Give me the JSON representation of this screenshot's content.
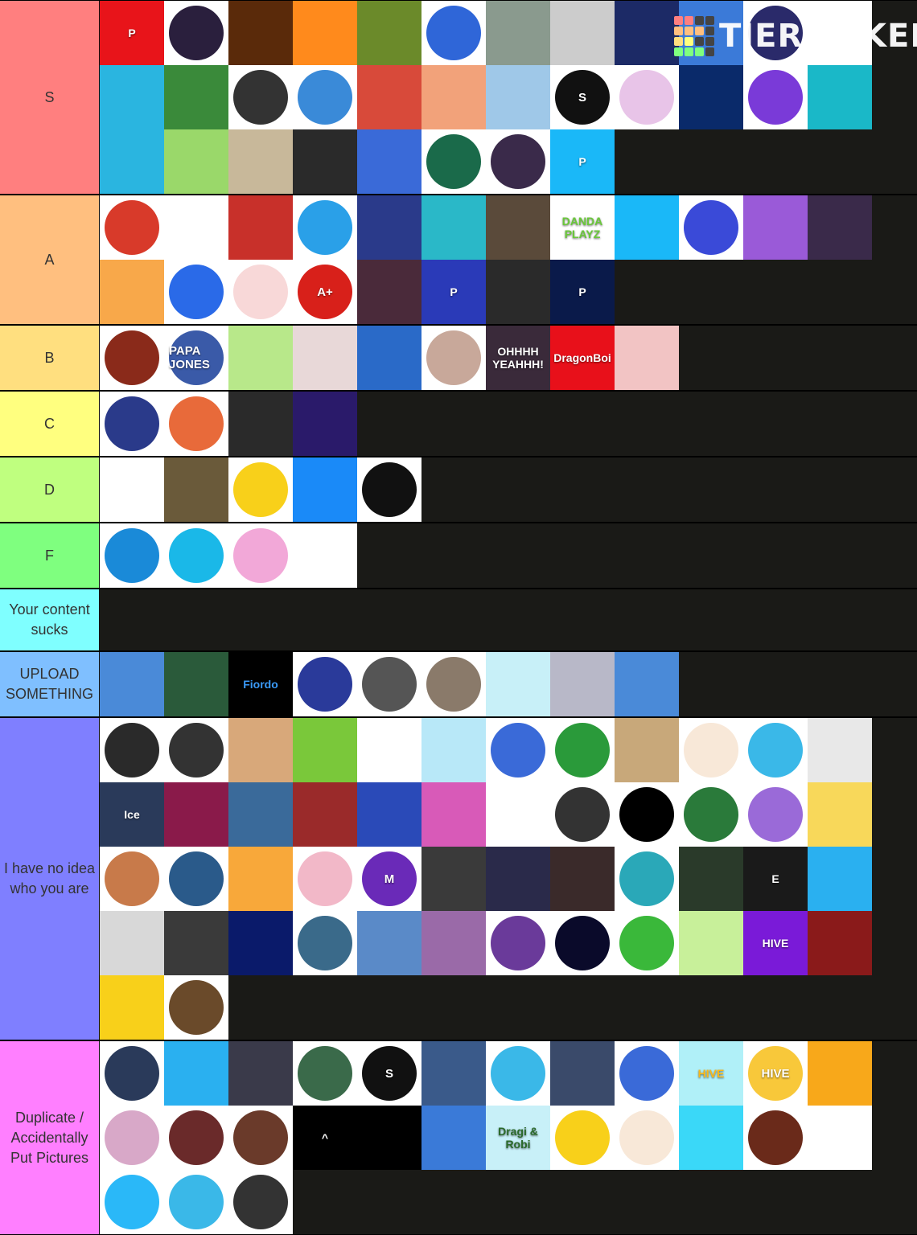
{
  "watermark": {
    "text": "TIERMAKER",
    "grid_colors": [
      "#ff7f7f",
      "#ff7f7f",
      "#444",
      "#444",
      "#ffbf7f",
      "#ffbf7f",
      "#ffbf7f",
      "#444",
      "#ffdf7f",
      "#ffff7f",
      "#444",
      "#444",
      "#7fff7f",
      "#7fff7f",
      "#7fff7f",
      "#444"
    ]
  },
  "tiers": [
    {
      "label": "S",
      "color": "#ff7f7f",
      "items": [
        {
          "bg": "#e8141a",
          "shape": "sq",
          "text": "P"
        },
        {
          "bg": "#fff",
          "fg": "#2a1f3d",
          "shape": "disc",
          "text": ""
        },
        {
          "bg": "#5a2a0a",
          "shape": "sq",
          "text": ""
        },
        {
          "bg": "#ff8a1c",
          "shape": "sq",
          "text": ""
        },
        {
          "bg": "#6b8a2a",
          "shape": "sq",
          "text": ""
        },
        {
          "bg": "#fff",
          "fg": "#2f66d8",
          "shape": "disc",
          "text": ""
        },
        {
          "bg": "#8a9a8e",
          "shape": "sq",
          "text": ""
        },
        {
          "bg": "#ccc",
          "fg": "#8a4a2a",
          "shape": "sq",
          "text": ""
        },
        {
          "bg": "#1c2a66",
          "shape": "sq",
          "text": ""
        },
        {
          "bg": "#3b7ad8",
          "shape": "sq",
          "text": ""
        },
        {
          "bg": "#fff",
          "fg": "#2a2a6a",
          "shape": "disc",
          "text": ""
        },
        {
          "bg": "#fff",
          "fg": "#7a5a2a",
          "shape": "sq",
          "text": ""
        },
        {
          "bg": "#2ab5e0",
          "shape": "sq",
          "text": ""
        },
        {
          "bg": "#3a8a3a",
          "shape": "sq",
          "text": ""
        },
        {
          "bg": "#fff",
          "fg": "#333",
          "shape": "disc",
          "text": ""
        },
        {
          "bg": "#fff",
          "fg": "#3a8ad8",
          "shape": "disc",
          "text": ""
        },
        {
          "bg": "#d84a3a",
          "shape": "sq",
          "text": ""
        },
        {
          "bg": "#f2a27a",
          "shape": "sq",
          "text": ""
        },
        {
          "bg": "#9fc8e8",
          "shape": "sq",
          "text": ""
        },
        {
          "bg": "#fff",
          "fg": "#111",
          "shape": "disc",
          "text": "S"
        },
        {
          "bg": "#fff",
          "fg": "#e8c4e8",
          "shape": "disc",
          "text": ""
        },
        {
          "bg": "#0a2a6a",
          "shape": "sq",
          "text": ""
        },
        {
          "bg": "#fff",
          "fg": "#7a3ad8",
          "shape": "disc",
          "text": ""
        },
        {
          "bg": "#1ab8c8",
          "shape": "sq",
          "text": ""
        },
        {
          "bg": "#2ab5e0",
          "shape": "sq",
          "text": ""
        },
        {
          "bg": "#9ad86a",
          "shape": "sq",
          "text": ""
        },
        {
          "bg": "#c8b89a",
          "shape": "sq",
          "text": ""
        },
        {
          "bg": "#2a2a2a",
          "shape": "sq",
          "text": ""
        },
        {
          "bg": "#3a6ad8",
          "shape": "sq",
          "text": ""
        },
        {
          "bg": "#fff",
          "fg": "#1a6a4a",
          "shape": "disc",
          "text": ""
        },
        {
          "bg": "#fff",
          "fg": "#3a2a4a",
          "shape": "disc",
          "text": ""
        },
        {
          "bg": "#1ab8f8",
          "shape": "sq",
          "text": "P"
        }
      ]
    },
    {
      "label": "A",
      "color": "#ffbf7f",
      "items": [
        {
          "bg": "#fff",
          "fg": "#d83a2a",
          "shape": "disc",
          "text": ""
        },
        {
          "bg": "#fff",
          "fg": "#111",
          "shape": "sq",
          "text": ""
        },
        {
          "bg": "#c8302a",
          "shape": "sq",
          "text": ""
        },
        {
          "bg": "#fff",
          "fg": "#2aa0e8",
          "shape": "disc",
          "text": ""
        },
        {
          "bg": "#2a3a8a",
          "shape": "sq",
          "text": ""
        },
        {
          "bg": "#2ab8c8",
          "shape": "sq",
          "text": ""
        },
        {
          "bg": "#5a4a3a",
          "shape": "sq",
          "text": ""
        },
        {
          "bg": "#fff",
          "fg": "#6ac83a",
          "shape": "sq",
          "text": "DANDA PLAYZ"
        },
        {
          "bg": "#1ab8f8",
          "shape": "sq",
          "text": ""
        },
        {
          "bg": "#fff",
          "fg": "#3a4ad8",
          "shape": "disc",
          "text": ""
        },
        {
          "bg": "#9a5ad8",
          "shape": "sq",
          "text": ""
        },
        {
          "bg": "#3a2a4a",
          "shape": "sq",
          "text": ""
        },
        {
          "bg": "#f8a84a",
          "shape": "sq",
          "text": ""
        },
        {
          "bg": "#fff",
          "fg": "#2a6ae8",
          "shape": "disc",
          "text": ""
        },
        {
          "bg": "#fff",
          "fg": "#f8d8d8",
          "shape": "disc",
          "text": ""
        },
        {
          "bg": "#fff",
          "fg": "#d8201a",
          "shape": "disc",
          "text": "A+"
        },
        {
          "bg": "#4a2a3a",
          "shape": "sq",
          "text": ""
        },
        {
          "bg": "#2a3ab8",
          "shape": "sq",
          "text": "P"
        },
        {
          "bg": "#2a2a2a",
          "shape": "sq",
          "text": ""
        },
        {
          "bg": "#0a1a4a",
          "shape": "sq",
          "text": "P"
        }
      ]
    },
    {
      "label": "B",
      "color": "#ffdf7f",
      "items": [
        {
          "bg": "#fff",
          "fg": "#8a2a1a",
          "shape": "disc",
          "text": ""
        },
        {
          "bg": "#fff",
          "fg": "#3a5aa8",
          "shape": "disc",
          "text": "PAPA JONES"
        },
        {
          "bg": "#b8e88a",
          "shape": "sq",
          "text": ""
        },
        {
          "bg": "#e8d8d8",
          "shape": "sq",
          "text": ""
        },
        {
          "bg": "#2a6ac8",
          "shape": "sq",
          "text": ""
        },
        {
          "bg": "#fff",
          "fg": "#c8a89a",
          "shape": "disc",
          "text": ""
        },
        {
          "bg": "#3a2a3a",
          "shape": "sq",
          "text": "OHHHH YEAHHH!"
        },
        {
          "bg": "#e8101a",
          "shape": "sq",
          "text": "DragonBoi"
        },
        {
          "bg": "#f2c4c4",
          "shape": "sq",
          "text": ""
        }
      ]
    },
    {
      "label": "C",
      "color": "#ffff7f",
      "items": [
        {
          "bg": "#fff",
          "fg": "#2a3a8a",
          "shape": "disc",
          "text": ""
        },
        {
          "bg": "#fff",
          "fg": "#e86a3a",
          "shape": "disc",
          "text": ""
        },
        {
          "bg": "#2a2a2a",
          "shape": "sq",
          "text": ""
        },
        {
          "bg": "#2a1a6a",
          "shape": "sq",
          "text": ""
        }
      ]
    },
    {
      "label": "D",
      "color": "#bfff7f",
      "items": [
        {
          "bg": "#fff",
          "fg": "#f8d83a",
          "shape": "sq",
          "text": ""
        },
        {
          "bg": "#6a5a3a",
          "shape": "sq",
          "text": ""
        },
        {
          "bg": "#fff",
          "fg": "#f8d01a",
          "shape": "disc",
          "text": ""
        },
        {
          "bg": "#1a8af8",
          "shape": "sq",
          "text": ""
        },
        {
          "bg": "#fff",
          "fg": "#111",
          "shape": "disc",
          "text": ""
        }
      ]
    },
    {
      "label": "F",
      "color": "#7fff7f",
      "items": [
        {
          "bg": "#fff",
          "fg": "#1a8ad8",
          "shape": "disc",
          "text": ""
        },
        {
          "bg": "#fff",
          "fg": "#1ab8e8",
          "shape": "disc",
          "text": ""
        },
        {
          "bg": "#fff",
          "fg": "#f2a8d8",
          "shape": "disc",
          "text": ""
        },
        {
          "bg": "#fff",
          "fg": "#d82a3a",
          "shape": "sq",
          "text": ""
        }
      ]
    },
    {
      "label": "Your content sucks",
      "color": "#7fffff",
      "items": []
    },
    {
      "label": "UPLOAD SOMETHING",
      "color": "#7fbfff",
      "items": [
        {
          "bg": "#4a8ad8",
          "shape": "sq",
          "text": ""
        },
        {
          "bg": "#2a5a3a",
          "shape": "sq",
          "text": ""
        },
        {
          "bg": "#000",
          "fg": "#3a9af8",
          "shape": "sq",
          "text": "Fiordo"
        },
        {
          "bg": "#fff",
          "fg": "#2a3a9a",
          "shape": "disc",
          "text": ""
        },
        {
          "bg": "#fff",
          "fg": "#555",
          "shape": "disc",
          "text": ""
        },
        {
          "bg": "#fff",
          "fg": "#8a7a6a",
          "shape": "disc",
          "text": ""
        },
        {
          "bg": "#c8f0f8",
          "shape": "sq",
          "text": ""
        },
        {
          "bg": "#b8b8c8",
          "shape": "sq",
          "text": ""
        },
        {
          "bg": "#4a8ad8",
          "shape": "sq",
          "text": ""
        }
      ]
    },
    {
      "label": "I have no idea who you are",
      "color": "#7f7fff",
      "items": [
        {
          "bg": "#fff",
          "fg": "#2a2a2a",
          "shape": "disc",
          "text": ""
        },
        {
          "bg": "#fff",
          "fg": "#333",
          "shape": "disc",
          "text": ""
        },
        {
          "bg": "#d8a87a",
          "shape": "sq",
          "text": ""
        },
        {
          "bg": "#7ac83a",
          "shape": "sq",
          "text": ""
        },
        {
          "bg": "#fff",
          "fg": "#b87a4a",
          "shape": "sq",
          "text": ""
        },
        {
          "bg": "#b8e8f8",
          "shape": "sq",
          "text": ""
        },
        {
          "bg": "#fff",
          "fg": "#3a6ad8",
          "shape": "disc",
          "text": ""
        },
        {
          "bg": "#fff",
          "fg": "#2a9a3a",
          "shape": "disc",
          "text": ""
        },
        {
          "bg": "#c8a87a",
          "shape": "sq",
          "text": ""
        },
        {
          "bg": "#fff",
          "fg": "#f8e8d8",
          "shape": "disc",
          "text": ""
        },
        {
          "bg": "#fff",
          "fg": "#3ab8e8",
          "shape": "disc",
          "text": ""
        },
        {
          "bg": "#e8e8e8",
          "shape": "sq",
          "text": ""
        },
        {
          "bg": "#2a3a5a",
          "shape": "sq",
          "text": "Ice"
        },
        {
          "bg": "#8a1a4a",
          "shape": "sq",
          "text": ""
        },
        {
          "bg": "#3a6a9a",
          "shape": "sq",
          "text": ""
        },
        {
          "bg": "#9a2a2a",
          "shape": "sq",
          "text": ""
        },
        {
          "bg": "#2a4ab8",
          "shape": "sq",
          "text": ""
        },
        {
          "bg": "#d85ab8",
          "shape": "sq",
          "text": ""
        },
        {
          "bg": "#fff",
          "fg": "#d82a2a",
          "shape": "sq",
          "text": ""
        },
        {
          "bg": "#fff",
          "fg": "#333",
          "shape": "disc",
          "text": ""
        },
        {
          "bg": "#fff",
          "fg": "#000",
          "shape": "disc",
          "text": ""
        },
        {
          "bg": "#fff",
          "fg": "#2a7a3a",
          "shape": "disc",
          "text": ""
        },
        {
          "bg": "#fff",
          "fg": "#9a6ad8",
          "shape": "disc",
          "text": ""
        },
        {
          "bg": "#f8d85a",
          "shape": "sq",
          "text": ""
        },
        {
          "bg": "#fff",
          "fg": "#c87a4a",
          "shape": "disc",
          "text": ""
        },
        {
          "bg": "#fff",
          "fg": "#2a5a8a",
          "shape": "disc",
          "text": ""
        },
        {
          "bg": "#f8a83a",
          "shape": "sq",
          "text": ""
        },
        {
          "bg": "#fff",
          "fg": "#f2b8c8",
          "shape": "disc",
          "text": ""
        },
        {
          "bg": "#fff",
          "fg": "#6a2ab8",
          "shape": "disc",
          "text": "M"
        },
        {
          "bg": "#3a3a3a",
          "shape": "sq",
          "text": ""
        },
        {
          "bg": "#2a2a4a",
          "shape": "sq",
          "text": ""
        },
        {
          "bg": "#3a2a2a",
          "shape": "sq",
          "text": ""
        },
        {
          "bg": "#fff",
          "fg": "#2aa8b8",
          "shape": "disc",
          "text": ""
        },
        {
          "bg": "#2a3a2a",
          "shape": "sq",
          "text": ""
        },
        {
          "bg": "#1a1a1a",
          "shape": "sq",
          "text": "E"
        },
        {
          "bg": "#2ab0f0",
          "shape": "sq",
          "text": ""
        },
        {
          "bg": "#d8d8d8",
          "shape": "sq",
          "text": ""
        },
        {
          "bg": "#3a3a3a",
          "shape": "sq",
          "text": ""
        },
        {
          "bg": "#0a1a6a",
          "shape": "sq",
          "text": ""
        },
        {
          "bg": "#fff",
          "fg": "#3a6a8a",
          "shape": "disc",
          "text": ""
        },
        {
          "bg": "#5a8ac8",
          "shape": "sq",
          "text": ""
        },
        {
          "bg": "#9a6aa8",
          "shape": "sq",
          "text": ""
        },
        {
          "bg": "#fff",
          "fg": "#6a3a9a",
          "shape": "disc",
          "text": ""
        },
        {
          "bg": "#fff",
          "fg": "#0a0a2a",
          "shape": "disc",
          "text": ""
        },
        {
          "bg": "#fff",
          "fg": "#3ab83a",
          "shape": "disc",
          "text": ""
        },
        {
          "bg": "#c8f09a",
          "shape": "sq",
          "text": ""
        },
        {
          "bg": "#7a1ad8",
          "shape": "sq",
          "text": "HIVE"
        },
        {
          "bg": "#8a1a1a",
          "shape": "sq",
          "text": ""
        },
        {
          "bg": "#f8d01a",
          "shape": "sq",
          "text": ""
        },
        {
          "bg": "#fff",
          "fg": "#6a4a2a",
          "shape": "disc",
          "text": ""
        }
      ]
    },
    {
      "label": "Duplicate / Accidentally Put Pictures",
      "color": "#ff7fff",
      "items": [
        {
          "bg": "#fff",
          "fg": "#2a3a5a",
          "shape": "disc",
          "text": ""
        },
        {
          "bg": "#2ab0f0",
          "shape": "sq",
          "text": ""
        },
        {
          "bg": "#3a3a4a",
          "shape": "sq",
          "text": ""
        },
        {
          "bg": "#fff",
          "fg": "#3a6a4a",
          "shape": "disc",
          "text": ""
        },
        {
          "bg": "#fff",
          "fg": "#111",
          "shape": "disc",
          "text": "S"
        },
        {
          "bg": "#3a5a8a",
          "shape": "sq",
          "text": ""
        },
        {
          "bg": "#fff",
          "fg": "#3ab8e8",
          "shape": "disc",
          "text": ""
        },
        {
          "bg": "#3a4a6a",
          "shape": "sq",
          "text": ""
        },
        {
          "bg": "#fff",
          "fg": "#3a6ad8",
          "shape": "disc",
          "text": ""
        },
        {
          "bg": "#b0f0f8",
          "fg": "#f8b81a",
          "shape": "sq",
          "text": "HIVE"
        },
        {
          "bg": "#fff",
          "fg": "#f8c83a",
          "shape": "disc",
          "text": "HIVE"
        },
        {
          "bg": "#f8a81a",
          "shape": "sq",
          "text": ""
        },
        {
          "bg": "#fff",
          "fg": "#d8a8c8",
          "shape": "disc",
          "text": ""
        },
        {
          "bg": "#fff",
          "fg": "#6a2a2a",
          "shape": "disc",
          "text": ""
        },
        {
          "bg": "#fff",
          "fg": "#6a3a2a",
          "shape": "disc",
          "text": ""
        },
        {
          "bg": "#000",
          "shape": "sq",
          "text": "^"
        },
        {
          "bg": "#000",
          "fg": "#c8a83a",
          "shape": "sq",
          "text": ""
        },
        {
          "bg": "#3a7ad8",
          "shape": "sq",
          "text": ""
        },
        {
          "bg": "#c8f0f8",
          "fg": "#2a6a2a",
          "shape": "sq",
          "text": "Dragi & Robi"
        },
        {
          "bg": "#fff",
          "fg": "#f8d01a",
          "shape": "disc",
          "text": ""
        },
        {
          "bg": "#fff",
          "fg": "#f8e8d8",
          "shape": "disc",
          "text": ""
        },
        {
          "bg": "#3ad8f8",
          "shape": "sq",
          "text": ""
        },
        {
          "bg": "#fff",
          "fg": "#6a2a1a",
          "shape": "disc",
          "text": ""
        },
        {
          "bg": "#fff",
          "fg": "#f8a8b8",
          "shape": "sq",
          "text": ""
        },
        {
          "bg": "#fff",
          "fg": "#2ab8f8",
          "shape": "disc",
          "text": ""
        },
        {
          "bg": "#fff",
          "fg": "#3ab8e8",
          "shape": "disc",
          "text": ""
        },
        {
          "bg": "#fff",
          "fg": "#333",
          "shape": "disc",
          "text": ""
        }
      ]
    }
  ]
}
